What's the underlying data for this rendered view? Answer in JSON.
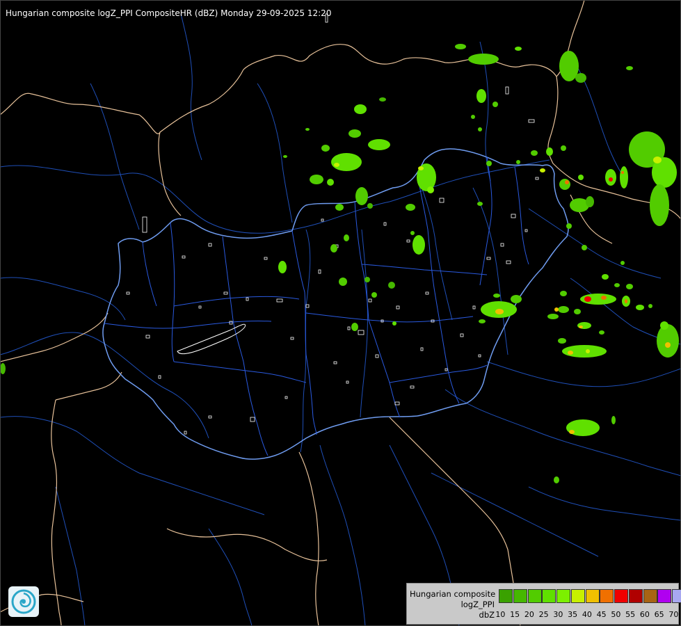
{
  "title": "Hungarian composite logZ_PPI CompositeHR (dBZ) Monday 29-09-2025 12:20",
  "legend": {
    "label_lines": [
      "Hungarian composite",
      "logZ_PPI",
      "dbZ"
    ],
    "levels": [
      {
        "value": "10",
        "color": "#3aa100"
      },
      {
        "value": "15",
        "color": "#46b800"
      },
      {
        "value": "20",
        "color": "#52cc00"
      },
      {
        "value": "25",
        "color": "#60e000"
      },
      {
        "value": "30",
        "color": "#7cf000"
      },
      {
        "value": "35",
        "color": "#c8f000"
      },
      {
        "value": "40",
        "color": "#f0c000"
      },
      {
        "value": "45",
        "color": "#f07000"
      },
      {
        "value": "50",
        "color": "#f00000"
      },
      {
        "value": "55",
        "color": "#b00000"
      },
      {
        "value": "60",
        "color": "#a86414"
      },
      {
        "value": "65",
        "color": "#b000f0"
      },
      {
        "value": "70",
        "color": "#a8a8f0"
      }
    ],
    "last_tick": "70"
  },
  "logo_icon": "radar-logo-icon"
}
